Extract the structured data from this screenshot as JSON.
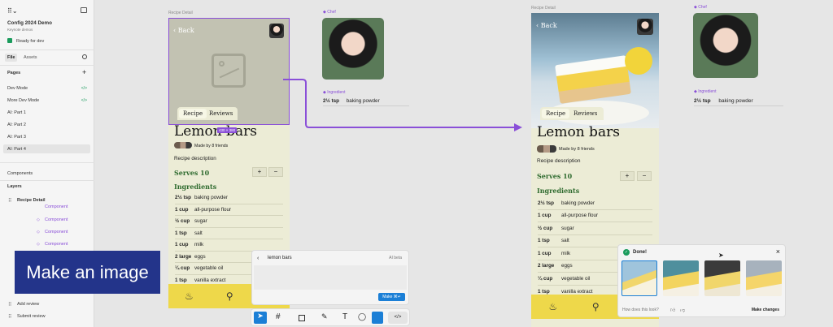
{
  "left_panel": {
    "file_title": "Config 2024 Demo",
    "file_subtitle": "Keynote demos",
    "status": "Ready for dev",
    "tabs": [
      "File",
      "Assets"
    ],
    "pages_header": "Pages",
    "pages": [
      {
        "label": "Dev Mode",
        "tag": "</>"
      },
      {
        "label": "More Dev Mode",
        "tag": "</>"
      },
      {
        "label": "AI: Part 1",
        "tag": ""
      },
      {
        "label": "AI: Part 2",
        "tag": ""
      },
      {
        "label": "AI: Part 3",
        "tag": ""
      },
      {
        "label": "AI: Part 4",
        "tag": ""
      }
    ],
    "components_header": "Components",
    "layers_header": "Layers",
    "layers": [
      "Recipe Detail",
      "Component",
      "Component",
      "Component",
      "Component"
    ],
    "bottom_layers": [
      "Add review",
      "Submit review"
    ]
  },
  "caption": "Make an image",
  "recipe_left": {
    "frame_label": "Recipe Detail",
    "back": "Back",
    "tabs": [
      "Recipe",
      "Reviews"
    ],
    "size_badge": "430 × 380",
    "title": "Lemon bars",
    "made_by": "Made by 8 friends",
    "description": "Recipe description",
    "serves_label": "Serves 10",
    "ingredients_header": "Ingredients",
    "ingredients": [
      {
        "q": "2½ tsp",
        "name": "baking powder"
      },
      {
        "q": "1 cup",
        "name": "all-purpose flour"
      },
      {
        "q": "½ cup",
        "name": "sugar"
      },
      {
        "q": "1 tsp",
        "name": "salt"
      },
      {
        "q": "1 cup",
        "name": "milk"
      },
      {
        "q": "2 large",
        "name": "eggs"
      },
      {
        "q": "¼ cup",
        "name": "vegetable oil"
      },
      {
        "q": "1 tsp",
        "name": "vanilla extract"
      }
    ]
  },
  "recipe_right": {
    "frame_label": "Recipe Detail",
    "back": "Back",
    "tabs": [
      "Recipe",
      "Reviews"
    ],
    "title": "Lemon bars",
    "made_by": "Made by 8 friends",
    "description": "Recipe description",
    "serves_label": "Serves 10",
    "ingredients_header": "Ingredients",
    "ingredients": [
      {
        "q": "2½ tsp",
        "name": "baking powder"
      },
      {
        "q": "1 cup",
        "name": "all-purpose flour"
      },
      {
        "q": "½ cup",
        "name": "sugar"
      },
      {
        "q": "1 tsp",
        "name": "salt"
      },
      {
        "q": "1 cup",
        "name": "milk"
      },
      {
        "q": "2 large",
        "name": "eggs"
      },
      {
        "q": "¼ cup",
        "name": "vegetable oil"
      },
      {
        "q": "1 tsp",
        "name": "vanilla extract"
      }
    ]
  },
  "chef_left": {
    "label": "Chef",
    "ingredient_label": "Ingredient",
    "q": "2½ tsp",
    "name": "baking powder"
  },
  "chef_right": {
    "label": "Chef",
    "ingredient_label": "Ingredient",
    "q": "2½ tsp",
    "name": "baking powder"
  },
  "ai_prompt": {
    "text": "lemon bars",
    "badge": "AI beta",
    "button": "Make ⌘↵"
  },
  "done_dialog": {
    "title": "Done!",
    "feedback": "How does this look?",
    "action": "Make changes"
  },
  "colors": {
    "accent": "#8a4fd8",
    "arrow": "#8a4fd8",
    "tabbar": "#eed84a",
    "frame_bg": "#ececd6",
    "heading_green": "#2f6b2f"
  }
}
